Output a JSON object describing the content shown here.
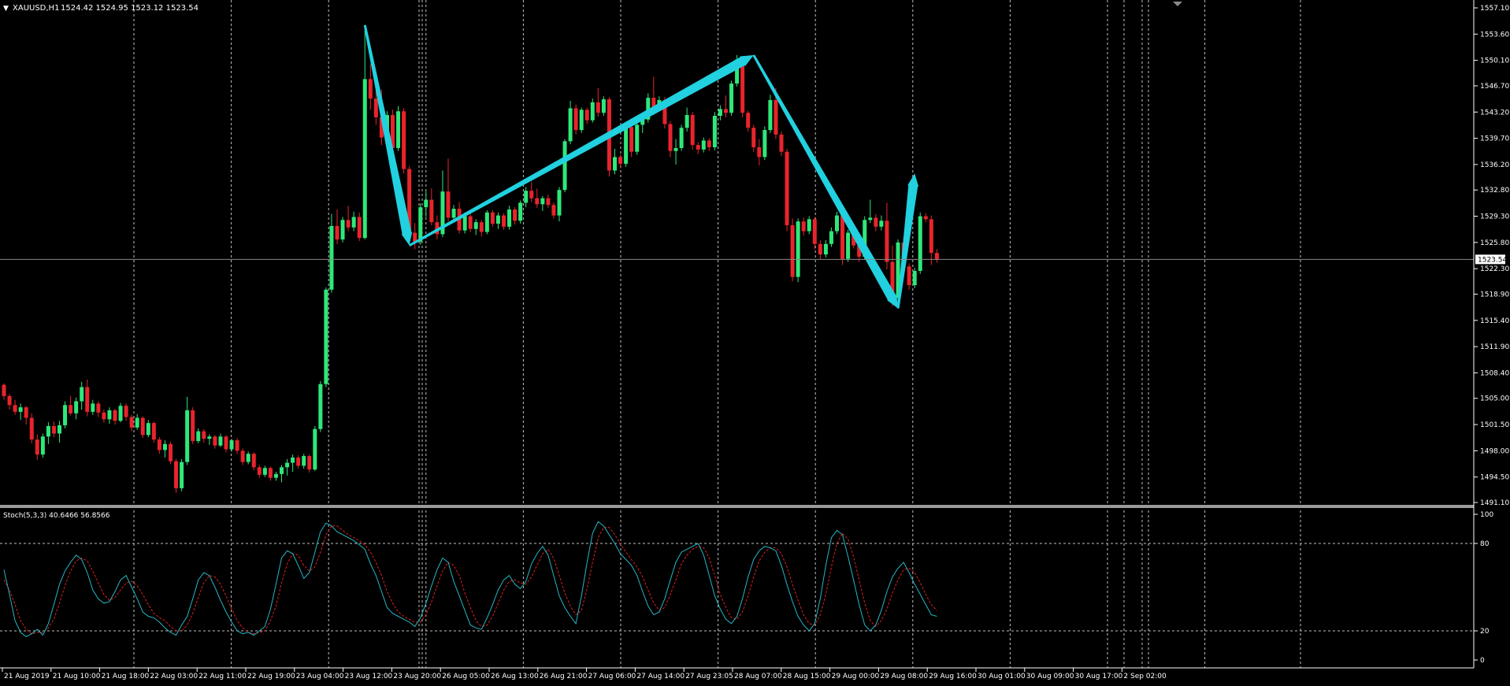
{
  "chart_window": {
    "title": "XAUUSD,H1",
    "ohlc_text": "1524.42 1524.95 1523.12 1523.54",
    "symbol_menu_glyph": "▼"
  },
  "price_axis": {
    "ticks": [
      "1557.10",
      "1553.60",
      "1550.10",
      "1546.70",
      "1543.20",
      "1539.70",
      "1536.20",
      "1532.80",
      "1529.30",
      "1525.80",
      "1522.30",
      "1518.90",
      "1515.40",
      "1511.90",
      "1508.40",
      "1505.00",
      "1501.50",
      "1498.00",
      "1494.50",
      "1491.10"
    ],
    "current_price": "1523.54"
  },
  "time_axis": {
    "labels": [
      "21 Aug 2019",
      "21 Aug 10:00",
      "21 Aug 18:00",
      "22 Aug 03:00",
      "22 Aug 11:00",
      "22 Aug 19:00",
      "23 Aug 04:00",
      "23 Aug 12:00",
      "23 Aug 20:00",
      "26 Aug 05:00",
      "26 Aug 13:00",
      "26 Aug 21:00",
      "27 Aug 06:00",
      "27 Aug 14:00",
      "27 Aug 23:05",
      "28 Aug 07:00",
      "28 Aug 15:00",
      "29 Aug 00:00",
      "29 Aug 08:00",
      "29 Aug 16:00",
      "30 Aug 01:00",
      "30 Aug 09:00",
      "30 Aug 17:00",
      "2 Sep 02:00"
    ]
  },
  "indicator": {
    "label": "Stoch(5,3,3) 40.6466 56.8566",
    "levels": [
      "100",
      "80",
      "20",
      "0"
    ]
  },
  "colors": {
    "background": "#000000",
    "bull": "#2ee87a",
    "bear": "#e8242c",
    "grid": "#ffffff",
    "arrow": "#21d1e0",
    "stoch_main": "#26b7c4",
    "stoch_signal": "#e02020",
    "axis_text": "#ffffff"
  },
  "chart_data": {
    "type": "candlestick",
    "price_range": [
      1491.1,
      1557.1
    ],
    "candles": [
      [
        1506.8,
        1507.0,
        1504.8,
        1505.3
      ],
      [
        1505.3,
        1505.6,
        1503.5,
        1504.1
      ],
      [
        1504.1,
        1504.8,
        1502.8,
        1503.2
      ],
      [
        1503.2,
        1504.3,
        1502.1,
        1503.8
      ],
      [
        1503.8,
        1504.0,
        1501.5,
        1502.4
      ],
      [
        1502.4,
        1503.0,
        1499.0,
        1499.5
      ],
      [
        1499.5,
        1500.2,
        1496.8,
        1497.5
      ],
      [
        1497.5,
        1500.3,
        1497.1,
        1499.9
      ],
      [
        1499.9,
        1501.8,
        1498.9,
        1501.3
      ],
      [
        1501.3,
        1501.9,
        1499.8,
        1500.3
      ],
      [
        1500.3,
        1502.0,
        1499.1,
        1501.4
      ],
      [
        1501.4,
        1504.6,
        1501.0,
        1504.1
      ],
      [
        1504.1,
        1505.3,
        1502.7,
        1503.0
      ],
      [
        1503.0,
        1505.1,
        1502.2,
        1504.6
      ],
      [
        1504.6,
        1507.2,
        1503.5,
        1506.5
      ],
      [
        1506.5,
        1507.5,
        1502.6,
        1503.2
      ],
      [
        1503.2,
        1504.8,
        1502.8,
        1504.3
      ],
      [
        1504.3,
        1504.6,
        1502.5,
        1503.1
      ],
      [
        1503.1,
        1503.5,
        1501.8,
        1502.2
      ],
      [
        1502.2,
        1503.8,
        1501.6,
        1503.4
      ],
      [
        1503.4,
        1503.6,
        1501.5,
        1502.0
      ],
      [
        1502.0,
        1504.4,
        1501.8,
        1504.0
      ],
      [
        1504.0,
        1504.3,
        1502.0,
        1502.5
      ],
      [
        1502.5,
        1502.8,
        1500.6,
        1501.1
      ],
      [
        1501.1,
        1502.9,
        1500.8,
        1502.4
      ],
      [
        1502.4,
        1502.6,
        1499.7,
        1500.1
      ],
      [
        1500.1,
        1502.1,
        1499.8,
        1501.7
      ],
      [
        1501.7,
        1501.9,
        1499.1,
        1499.5
      ],
      [
        1499.5,
        1499.8,
        1497.6,
        1498.1
      ],
      [
        1498.1,
        1499.4,
        1497.1,
        1498.9
      ],
      [
        1498.9,
        1499.2,
        1496.2,
        1496.6
      ],
      [
        1496.6,
        1496.9,
        1492.4,
        1493.0
      ],
      [
        1493.0,
        1496.9,
        1492.6,
        1496.5
      ],
      [
        1496.5,
        1505.2,
        1496.1,
        1503.4
      ],
      [
        1503.4,
        1503.8,
        1498.9,
        1499.3
      ],
      [
        1499.3,
        1501.0,
        1499.0,
        1500.6
      ],
      [
        1500.6,
        1500.9,
        1499.1,
        1499.6
      ],
      [
        1499.6,
        1500.2,
        1498.8,
        1499.9
      ],
      [
        1499.9,
        1500.1,
        1498.3,
        1498.7
      ],
      [
        1498.7,
        1500.3,
        1498.5,
        1499.9
      ],
      [
        1499.9,
        1500.1,
        1497.8,
        1498.2
      ],
      [
        1498.2,
        1499.6,
        1497.9,
        1499.4
      ],
      [
        1499.4,
        1499.7,
        1497.6,
        1498.0
      ],
      [
        1498.0,
        1498.3,
        1496.1,
        1496.5
      ],
      [
        1496.5,
        1497.9,
        1496.2,
        1497.6
      ],
      [
        1497.6,
        1497.8,
        1495.4,
        1495.8
      ],
      [
        1495.8,
        1496.1,
        1494.4,
        1494.8
      ],
      [
        1494.8,
        1496.0,
        1494.5,
        1495.7
      ],
      [
        1495.7,
        1495.9,
        1494.0,
        1494.4
      ],
      [
        1494.4,
        1495.2,
        1494.0,
        1494.9
      ],
      [
        1494.9,
        1496.1,
        1493.8,
        1495.8
      ],
      [
        1495.8,
        1496.9,
        1494.7,
        1496.4
      ],
      [
        1496.4,
        1497.5,
        1495.2,
        1497.1
      ],
      [
        1497.1,
        1497.4,
        1495.6,
        1496.0
      ],
      [
        1496.0,
        1497.6,
        1495.6,
        1497.3
      ],
      [
        1497.3,
        1497.5,
        1495.1,
        1495.5
      ],
      [
        1495.5,
        1501.3,
        1495.3,
        1500.9
      ],
      [
        1500.9,
        1507.3,
        1500.5,
        1506.9
      ],
      [
        1506.9,
        1519.8,
        1506.5,
        1519.5
      ],
      [
        1519.5,
        1529.6,
        1519.1,
        1528.0
      ],
      [
        1528.0,
        1530.2,
        1525.6,
        1526.2
      ],
      [
        1526.2,
        1529.2,
        1525.8,
        1528.8
      ],
      [
        1528.8,
        1530.7,
        1527.3,
        1527.8
      ],
      [
        1527.8,
        1529.9,
        1527.3,
        1529.2
      ],
      [
        1529.2,
        1529.8,
        1526.0,
        1526.4
      ],
      [
        1526.4,
        1554.8,
        1526.2,
        1547.6
      ],
      [
        1547.6,
        1549.6,
        1543.5,
        1545.0
      ],
      [
        1545.0,
        1548.0,
        1541.5,
        1542.5
      ],
      [
        1542.5,
        1546.2,
        1538.8,
        1539.8
      ],
      [
        1539.8,
        1543.3,
        1538.5,
        1542.8
      ],
      [
        1542.8,
        1543.5,
        1537.9,
        1538.4
      ],
      [
        1538.4,
        1544.0,
        1538.0,
        1543.3
      ],
      [
        1543.3,
        1543.7,
        1535.0,
        1535.6
      ],
      [
        1535.6,
        1536.0,
        1526.5,
        1527.1
      ],
      [
        1527.1,
        1528.4,
        1524.9,
        1525.9
      ],
      [
        1525.9,
        1531.0,
        1525.5,
        1530.5
      ],
      [
        1530.5,
        1532.6,
        1529.2,
        1531.5
      ],
      [
        1531.5,
        1533.0,
        1528.1,
        1528.5
      ],
      [
        1528.5,
        1529.4,
        1526.2,
        1526.9
      ],
      [
        1526.9,
        1535.4,
        1526.5,
        1532.6
      ],
      [
        1532.6,
        1537.0,
        1528.6,
        1529.1
      ],
      [
        1529.1,
        1530.8,
        1528.5,
        1530.3
      ],
      [
        1530.3,
        1531.2,
        1527.0,
        1527.4
      ],
      [
        1527.4,
        1529.8,
        1527.0,
        1529.3
      ],
      [
        1529.3,
        1529.6,
        1527.2,
        1527.6
      ],
      [
        1527.6,
        1528.9,
        1526.8,
        1528.5
      ],
      [
        1528.5,
        1528.8,
        1526.6,
        1527.2
      ],
      [
        1527.2,
        1530.1,
        1526.9,
        1529.8
      ],
      [
        1529.8,
        1530.1,
        1527.9,
        1528.3
      ],
      [
        1528.3,
        1529.8,
        1527.6,
        1529.4
      ],
      [
        1529.4,
        1529.7,
        1527.5,
        1527.9
      ],
      [
        1527.9,
        1530.7,
        1527.5,
        1530.2
      ],
      [
        1530.2,
        1530.5,
        1528.2,
        1528.7
      ],
      [
        1528.7,
        1531.4,
        1528.3,
        1531.1
      ],
      [
        1531.1,
        1533.2,
        1530.5,
        1532.7
      ],
      [
        1532.7,
        1533.9,
        1531.2,
        1531.7
      ],
      [
        1531.7,
        1533.0,
        1530.4,
        1530.9
      ],
      [
        1530.9,
        1532.0,
        1530.0,
        1531.7
      ],
      [
        1531.7,
        1532.2,
        1530.4,
        1530.8
      ],
      [
        1530.8,
        1531.1,
        1529.0,
        1529.4
      ],
      [
        1529.4,
        1533.2,
        1528.6,
        1532.8
      ],
      [
        1532.8,
        1539.6,
        1532.5,
        1539.3
      ],
      [
        1539.3,
        1544.7,
        1538.9,
        1543.7
      ],
      [
        1543.7,
        1544.2,
        1540.2,
        1540.8
      ],
      [
        1540.8,
        1543.8,
        1540.4,
        1543.5
      ],
      [
        1543.5,
        1543.8,
        1541.6,
        1542.1
      ],
      [
        1542.1,
        1545.0,
        1541.8,
        1544.5
      ],
      [
        1544.5,
        1546.4,
        1542.6,
        1543.1
      ],
      [
        1543.1,
        1545.3,
        1542.7,
        1544.9
      ],
      [
        1544.9,
        1545.2,
        1534.6,
        1535.4
      ],
      [
        1535.4,
        1538.3,
        1534.9,
        1537.2
      ],
      [
        1537.2,
        1537.5,
        1535.7,
        1536.3
      ],
      [
        1536.3,
        1541.9,
        1535.9,
        1541.2
      ],
      [
        1541.2,
        1541.7,
        1537.2,
        1537.9
      ],
      [
        1537.9,
        1541.9,
        1537.5,
        1541.5
      ],
      [
        1541.5,
        1542.7,
        1540.4,
        1542.2
      ],
      [
        1542.2,
        1545.7,
        1541.8,
        1545.1
      ],
      [
        1545.1,
        1547.9,
        1542.8,
        1543.7
      ],
      [
        1543.7,
        1545.3,
        1543.3,
        1544.8
      ],
      [
        1544.8,
        1545.2,
        1541.0,
        1541.6
      ],
      [
        1541.6,
        1542.0,
        1537.2,
        1538.0
      ],
      [
        1538.0,
        1539.6,
        1536.2,
        1538.4
      ],
      [
        1538.4,
        1541.5,
        1538.0,
        1541.1
      ],
      [
        1541.1,
        1543.8,
        1540.6,
        1542.8
      ],
      [
        1542.8,
        1543.2,
        1538.2,
        1538.8
      ],
      [
        1538.8,
        1539.2,
        1537.6,
        1538.2
      ],
      [
        1538.2,
        1539.8,
        1537.8,
        1539.4
      ],
      [
        1539.4,
        1539.7,
        1538.0,
        1538.5
      ],
      [
        1538.5,
        1543.2,
        1538.1,
        1542.7
      ],
      [
        1542.7,
        1544.1,
        1542.1,
        1543.6
      ],
      [
        1543.6,
        1545.4,
        1542.5,
        1543.1
      ],
      [
        1543.1,
        1547.4,
        1542.7,
        1547.0
      ],
      [
        1547.0,
        1550.8,
        1546.6,
        1550.2
      ],
      [
        1550.2,
        1550.5,
        1542.5,
        1543.1
      ],
      [
        1543.1,
        1543.4,
        1540.6,
        1541.1
      ],
      [
        1541.1,
        1541.5,
        1537.9,
        1538.5
      ],
      [
        1538.5,
        1539.6,
        1536.1,
        1537.2
      ],
      [
        1537.2,
        1541.3,
        1536.8,
        1540.8
      ],
      [
        1540.8,
        1545.5,
        1540.4,
        1544.8
      ],
      [
        1544.8,
        1546.4,
        1539.6,
        1540.2
      ],
      [
        1540.2,
        1540.6,
        1537.3,
        1537.9
      ],
      [
        1537.9,
        1538.3,
        1527.3,
        1528.1
      ],
      [
        1528.1,
        1529.0,
        1520.6,
        1521.2
      ],
      [
        1521.2,
        1529.0,
        1520.5,
        1528.6
      ],
      [
        1528.6,
        1529.1,
        1526.7,
        1527.3
      ],
      [
        1527.3,
        1529.3,
        1526.9,
        1528.9
      ],
      [
        1528.9,
        1529.2,
        1524.9,
        1525.6
      ],
      [
        1525.6,
        1526.1,
        1523.6,
        1524.2
      ],
      [
        1524.2,
        1526.1,
        1523.8,
        1525.6
      ],
      [
        1525.6,
        1527.8,
        1525.2,
        1527.3
      ],
      [
        1527.3,
        1529.9,
        1526.9,
        1529.4
      ],
      [
        1529.4,
        1530.2,
        1522.8,
        1523.6
      ],
      [
        1523.6,
        1527.5,
        1523.2,
        1527.1
      ],
      [
        1527.1,
        1527.4,
        1525.0,
        1525.4
      ],
      [
        1525.4,
        1525.8,
        1523.2,
        1523.9
      ],
      [
        1523.9,
        1529.3,
        1523.5,
        1528.8
      ],
      [
        1528.8,
        1531.5,
        1528.4,
        1529.1
      ],
      [
        1529.1,
        1529.6,
        1527.3,
        1527.9
      ],
      [
        1527.9,
        1529.4,
        1527.4,
        1528.7
      ],
      [
        1528.7,
        1531.1,
        1522.2,
        1523.2
      ],
      [
        1523.2,
        1525.4,
        1517.3,
        1518.4
      ],
      [
        1518.4,
        1526.2,
        1518.0,
        1525.8
      ],
      [
        1525.8,
        1526.4,
        1522.0,
        1522.6
      ],
      [
        1522.6,
        1523.0,
        1519.5,
        1520.1
      ],
      [
        1520.1,
        1522.4,
        1519.7,
        1522.0
      ],
      [
        1522.0,
        1529.8,
        1521.6,
        1529.3
      ],
      [
        1529.3,
        1529.7,
        1528.5,
        1528.9
      ],
      [
        1528.9,
        1529.4,
        1522.8,
        1524.4
      ],
      [
        1524.4,
        1524.9,
        1523.1,
        1523.5
      ]
    ],
    "stochastic": {
      "main": [
        62,
        45,
        27,
        19,
        16,
        18,
        21,
        17,
        25,
        38,
        52,
        61,
        67,
        72,
        69,
        60,
        48,
        42,
        39,
        40,
        47,
        55,
        58,
        50,
        42,
        33,
        30,
        29,
        26,
        22,
        19,
        17,
        24,
        30,
        42,
        55,
        60,
        58,
        50,
        41,
        33,
        26,
        20,
        18,
        19,
        17,
        20,
        23,
        35,
        52,
        70,
        75,
        73,
        65,
        56,
        60,
        74,
        88,
        94,
        92,
        88,
        86,
        84,
        82,
        79,
        76,
        66,
        58,
        47,
        36,
        32,
        30,
        28,
        26,
        23,
        29,
        39,
        51,
        62,
        70,
        67,
        54,
        44,
        34,
        24,
        22,
        21,
        29,
        38,
        48,
        55,
        58,
        52,
        49,
        54,
        66,
        73,
        78,
        72,
        58,
        44,
        36,
        30,
        25,
        44,
        67,
        87,
        95,
        92,
        86,
        80,
        73,
        69,
        65,
        58,
        47,
        37,
        31,
        33,
        42,
        55,
        67,
        74,
        76,
        78,
        80,
        72,
        58,
        44,
        35,
        28,
        25,
        30,
        42,
        57,
        69,
        75,
        78,
        77,
        75,
        65,
        52,
        40,
        30,
        24,
        20,
        25,
        42,
        65,
        84,
        89,
        86,
        71,
        55,
        38,
        24,
        20,
        24,
        34,
        47,
        57,
        63,
        67,
        60,
        52,
        45,
        38,
        31,
        30
      ],
      "signal": [
        55,
        48,
        38,
        27,
        21,
        18,
        19,
        19,
        22,
        28,
        39,
        51,
        61,
        68,
        70,
        68,
        61,
        53,
        45,
        41,
        43,
        48,
        53,
        54,
        51,
        45,
        38,
        32,
        29,
        27,
        23,
        20,
        20,
        24,
        32,
        43,
        53,
        58,
        57,
        52,
        44,
        35,
        27,
        22,
        19,
        18,
        19,
        20,
        27,
        37,
        53,
        66,
        73,
        72,
        65,
        61,
        64,
        74,
        86,
        92,
        92,
        89,
        86,
        84,
        82,
        79,
        74,
        67,
        58,
        47,
        39,
        33,
        30,
        28,
        26,
        26,
        31,
        40,
        51,
        61,
        67,
        65,
        58,
        46,
        36,
        27,
        23,
        24,
        30,
        39,
        48,
        54,
        55,
        53,
        52,
        57,
        65,
        73,
        76,
        70,
        58,
        46,
        37,
        31,
        34,
        49,
        67,
        84,
        91,
        91,
        86,
        80,
        74,
        69,
        64,
        57,
        48,
        39,
        34,
        36,
        45,
        55,
        66,
        72,
        76,
        78,
        77,
        70,
        58,
        45,
        36,
        29,
        28,
        33,
        44,
        57,
        68,
        74,
        77,
        77,
        73,
        64,
        52,
        41,
        31,
        25,
        24,
        31,
        45,
        64,
        80,
        87,
        83,
        71,
        55,
        39,
        27,
        23,
        27,
        35,
        46,
        55,
        62,
        63,
        60,
        53,
        45,
        38,
        34
      ],
      "range": [
        0,
        100
      ],
      "levels": [
        80,
        20
      ]
    },
    "trend_arrows": [
      {
        "from_bar": 65,
        "from_price": 1554.8,
        "to_bar": 73,
        "to_price": 1525.4
      },
      {
        "from_bar": 73,
        "from_price": 1525.4,
        "to_bar": 135,
        "to_price": 1550.8
      },
      {
        "from_bar": 135,
        "from_price": 1550.8,
        "to_bar": 161,
        "to_price": 1517.0
      },
      {
        "from_bar": 161,
        "from_price": 1517.0,
        "to_bar": 164,
        "to_price": 1535.0
      }
    ]
  }
}
